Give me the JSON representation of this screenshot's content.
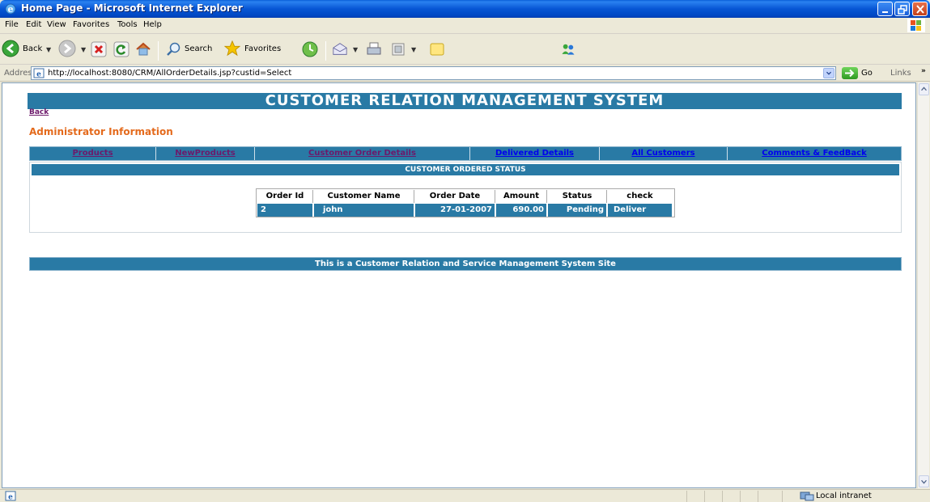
{
  "window": {
    "title": "Home Page - Microsoft Internet Explorer"
  },
  "menu": [
    "File",
    "Edit",
    "View",
    "Favorites",
    "Tools",
    "Help"
  ],
  "toolbar": {
    "back_label": "Back",
    "search_label": "Search",
    "favorites_label": "Favorites"
  },
  "address": {
    "label": "Address",
    "url": "http://localhost:8080/CRM/AllOrderDetails.jsp?custid=Select",
    "go_label": "Go",
    "links_label": "Links"
  },
  "page": {
    "banner": "CUSTOMER RELATION MANAGEMENT SYSTEM",
    "back_link": "Back",
    "admin_title": "Administrator Information",
    "nav": [
      {
        "label": "Products"
      },
      {
        "label": "NewProducts"
      },
      {
        "label": "Customer Order Details"
      },
      {
        "label": "Delivered Details"
      },
      {
        "label": "All Customers"
      },
      {
        "label": "Comments & FeedBack"
      }
    ],
    "status_heading": "CUSTOMER ORDERED STATUS",
    "table": {
      "headers": [
        "Order Id",
        "Customer Name",
        "Order Date",
        "Amount",
        "Status",
        "check"
      ],
      "rows": [
        [
          "2",
          "john",
          "27-01-2007",
          "690.00",
          "Pending",
          "Deliver"
        ]
      ]
    },
    "footer": "This is a Customer Relation and Service Management System Site"
  },
  "statusbar": {
    "zone": "Local intranet"
  },
  "colors": {
    "accent": "#297aa5",
    "admin_title": "#e46a1c",
    "visited_link": "#6c1a6b",
    "link": "#0000ee"
  }
}
